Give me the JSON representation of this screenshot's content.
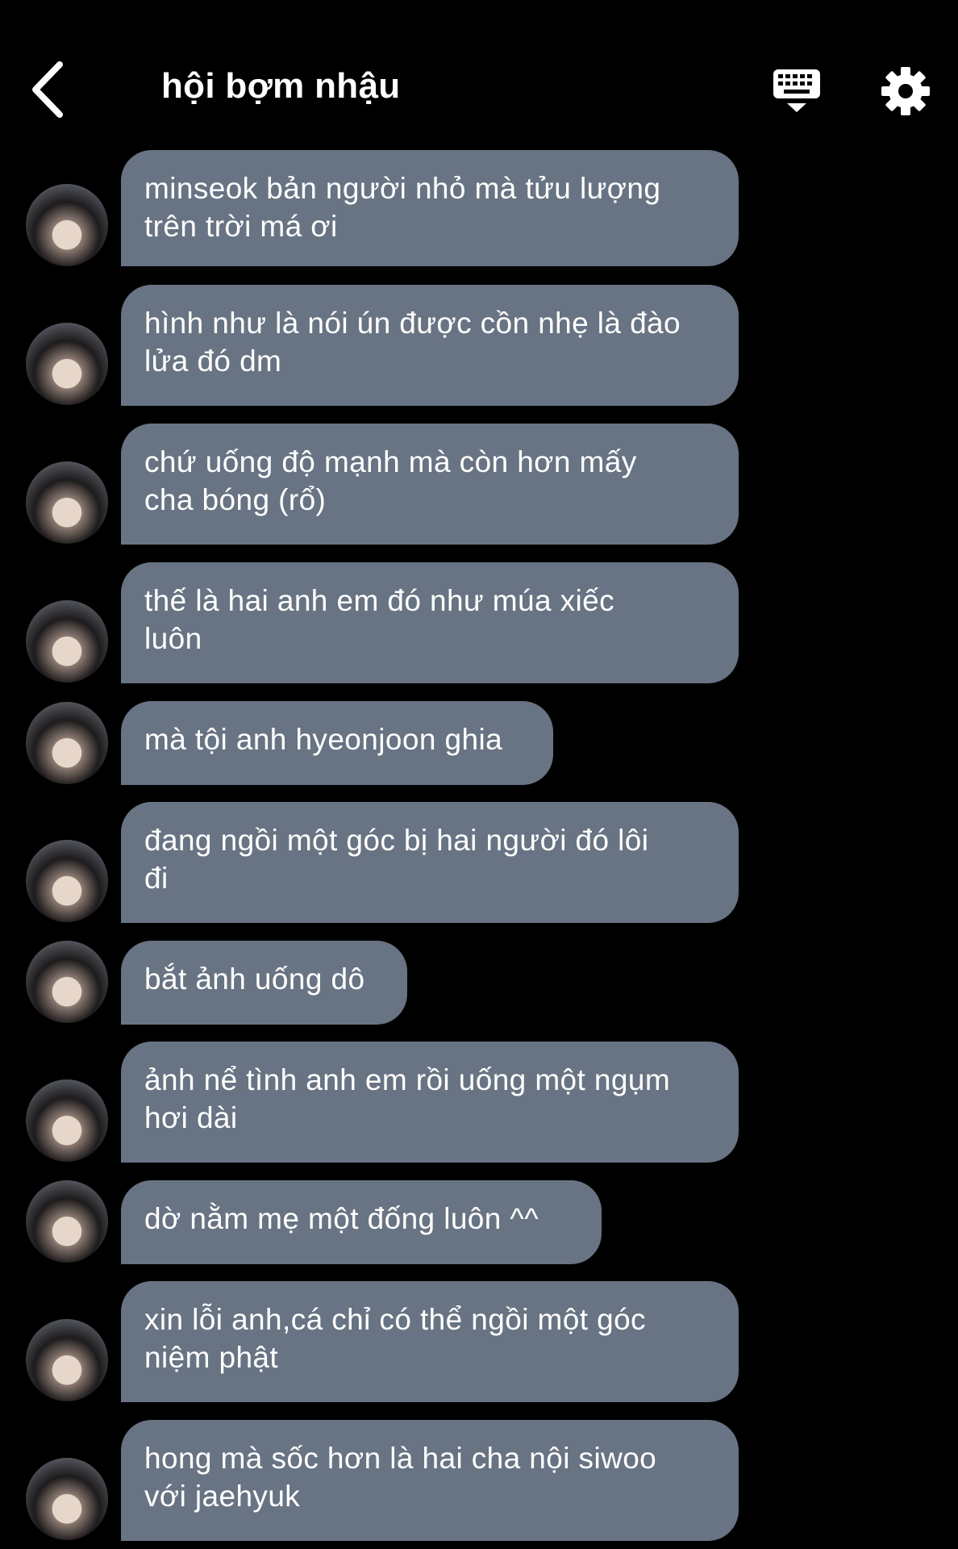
{
  "header": {
    "title": "hội bợm nhậu",
    "back_icon": "chevron-left-icon",
    "keyboard_icon": "keyboard-icon",
    "settings_icon": "gear-icon"
  },
  "colors": {
    "background": "#000000",
    "bubble": "#687483",
    "text": "#ffffff"
  },
  "messages": [
    {
      "text": "minseok bản người nhỏ mà tửu lượng\ntrên trời má ơi"
    },
    {
      "text": "hình như là nói ún được cồn nhẹ là đào\nlửa đó dm"
    },
    {
      "text": "chứ uống độ mạnh mà còn hơn mấy\ncha bóng (rổ)"
    },
    {
      "text": "thế là hai anh em đó như múa xiếc\nluôn"
    },
    {
      "text": "mà tội anh hyeonjoon ghia"
    },
    {
      "text": "đang ngồi một góc bị hai người đó lôi\nđi"
    },
    {
      "text": "bắt ảnh uống dô"
    },
    {
      "text": "ảnh nể tình anh em rồi uống một ngụm\nhơi dài"
    },
    {
      "text": "dờ nằm mẹ một đống luôn ^^"
    },
    {
      "text": "xin lỗi anh,cá chỉ có thể ngồi một góc\nniệm phật"
    },
    {
      "text": "hong mà sốc hơn là hai cha nội siwoo\nvới jaehyuk"
    }
  ]
}
